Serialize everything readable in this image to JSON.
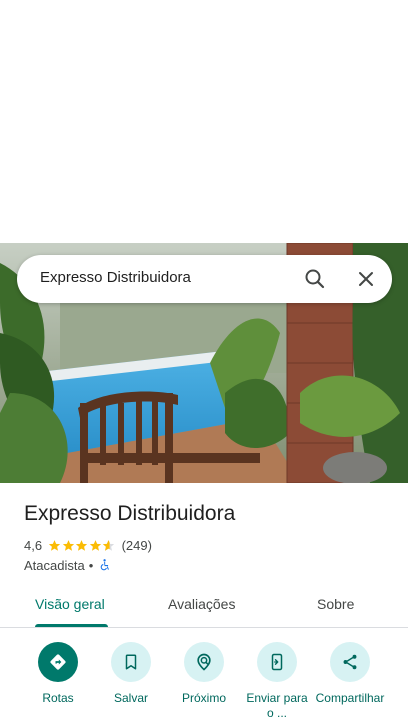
{
  "search": {
    "query": "Expresso Distribuidora"
  },
  "place": {
    "name": "Expresso Distribuidora",
    "rating": "4,6",
    "stars": 4.6,
    "review_count": "(249)",
    "category": "Atacadista",
    "separator": "•"
  },
  "tabs": [
    {
      "label": "Visão geral",
      "active": true
    },
    {
      "label": "Avaliações",
      "active": false
    },
    {
      "label": "Sobre",
      "active": false
    }
  ],
  "actions": [
    {
      "label": "Rotas",
      "icon": "directions-icon"
    },
    {
      "label": "Salvar",
      "icon": "bookmark-icon"
    },
    {
      "label": "Próximo",
      "icon": "nearby-icon"
    },
    {
      "label": "Enviar para o ...",
      "icon": "send-to-phone-icon"
    },
    {
      "label": "Compartilhar",
      "icon": "share-icon"
    }
  ],
  "colors": {
    "accent": "#00796b",
    "action_circle": "#d7f2f3",
    "star": "#fbbc04",
    "accessible": "#1a73e8"
  }
}
